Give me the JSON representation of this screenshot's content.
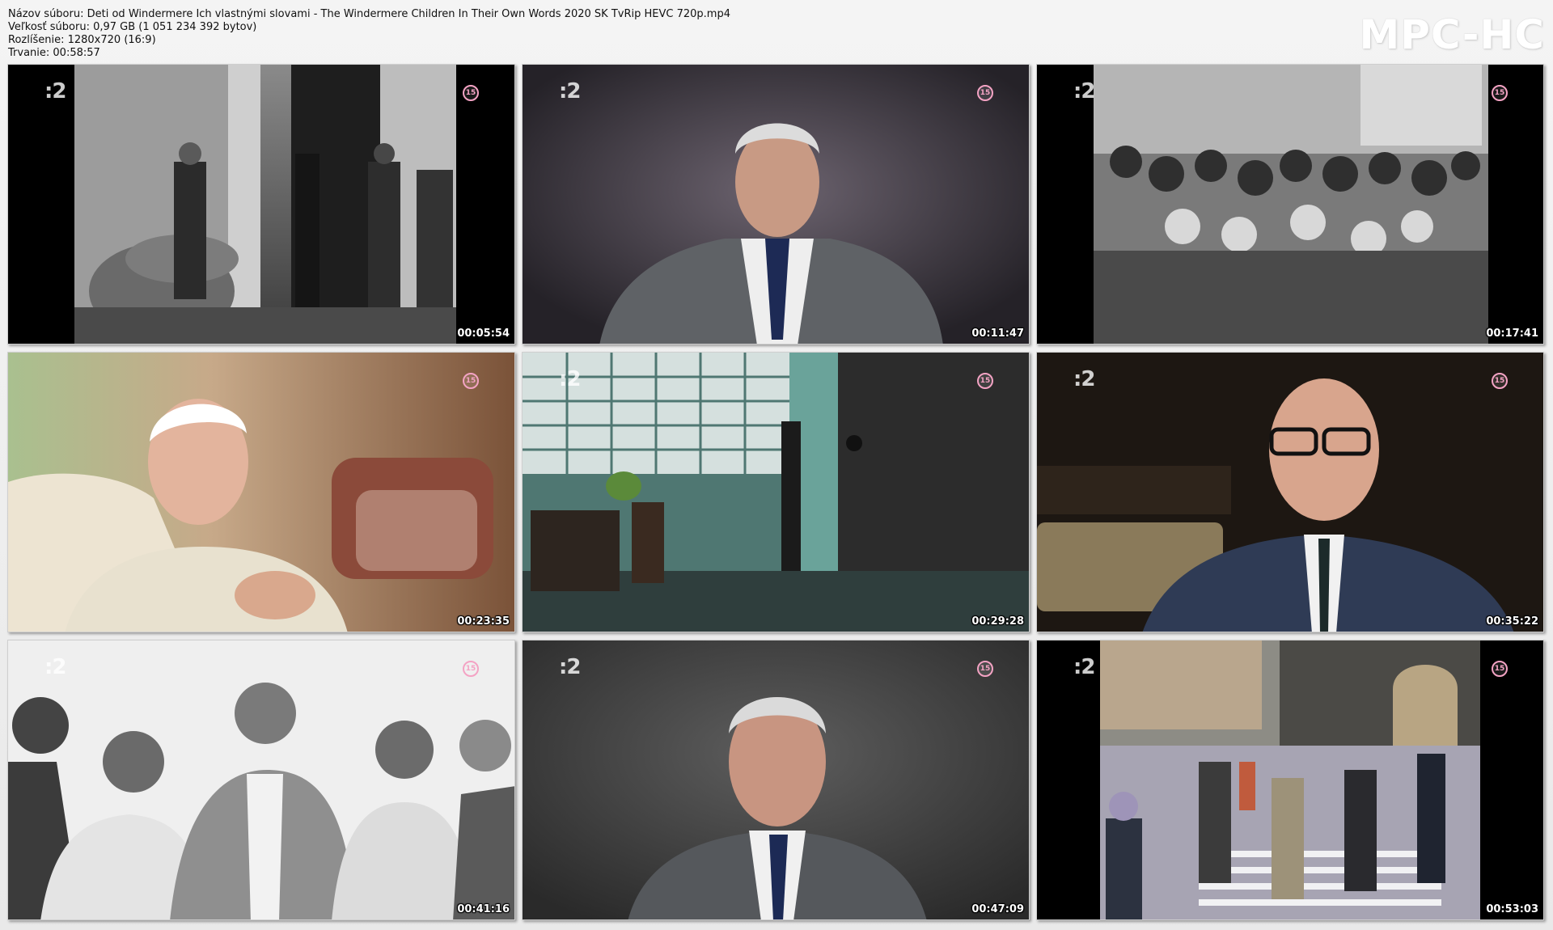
{
  "header": {
    "filename_label": "Názov súboru:",
    "filename": "Deti od Windermere Ich vlastnými slovami - The Windermere Children In Their Own Words 2020 SK TvRip HEVC 720p.mp4",
    "filesize_label": "Veľkosť súboru:",
    "filesize": "0,97 GB (1 051 234 392 bytov)",
    "resolution_label": "Rozlíšenie:",
    "resolution": "1280x720 (16:9)",
    "duration_label": "Trvanie:",
    "duration": "00:58:57"
  },
  "brand": {
    "logo_text": "MPC-HC",
    "rating_color": "#f4a3c4"
  },
  "thumbnails": [
    {
      "timestamp": "00:05:54",
      "channel_logo": ":2",
      "rating": "15"
    },
    {
      "timestamp": "00:11:47",
      "channel_logo": ":2",
      "rating": "15"
    },
    {
      "timestamp": "00:17:41",
      "channel_logo": ":2",
      "rating": "15"
    },
    {
      "timestamp": "00:23:35",
      "channel_logo": "",
      "rating": "15"
    },
    {
      "timestamp": "00:29:28",
      "channel_logo": ":2",
      "rating": "15"
    },
    {
      "timestamp": "00:35:22",
      "channel_logo": ":2",
      "rating": "15"
    },
    {
      "timestamp": "00:41:16",
      "channel_logo": ":2",
      "rating": "15"
    },
    {
      "timestamp": "00:47:09",
      "channel_logo": ":2",
      "rating": "15"
    },
    {
      "timestamp": "00:53:03",
      "channel_logo": ":2",
      "rating": "15"
    }
  ]
}
